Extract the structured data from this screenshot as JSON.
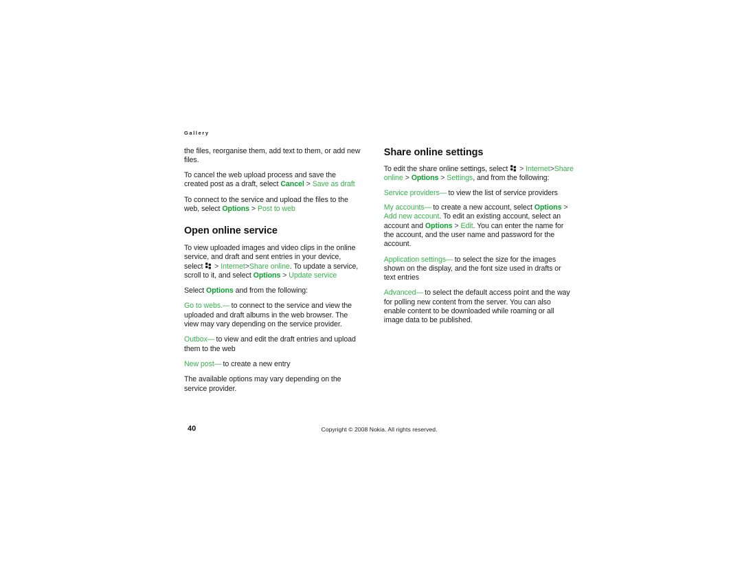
{
  "page": {
    "running_head": "Gallery",
    "folio": "40",
    "copyright": "Copyright © 2008 Nokia. All rights reserved."
  },
  "left_column": {
    "para_continued": {
      "text": "the files, reorganise them, add text to them, or add new files."
    },
    "para_cancel": {
      "lead": "To cancel the web upload process and save the created post as a draft, select ",
      "ui_cancel": "Cancel",
      "sep": " > ",
      "ui_save_as_draft": "Save as draft"
    },
    "para_connect": {
      "lead": "To connect to the service and upload the files to the web, select ",
      "ui_options": "Options",
      "sep": " > ",
      "ui_post_to_web": "Post to web"
    },
    "heading_open_online_service": "Open online service",
    "para_view": {
      "lead": "To view uploaded images and video clips in the online service, and draft and sent entries in your device, select ",
      "icon": "menu-grid-icon",
      "sep1": " > ",
      "ui_internet": "Internet",
      "sep2": ">",
      "ui_share_online": "Share online",
      "mid": ". To update a service, scroll to it, and select ",
      "ui_options": "Options",
      "sep3": " > ",
      "ui_update_service": "Update service"
    },
    "para_select_options": {
      "lead": "Select ",
      "ui_options": "Options",
      "tail": " and from the following:"
    },
    "item_go_to_webs": {
      "term": "Go to webs.",
      "dash": "—",
      "desc": " to connect to the service and view the uploaded and draft albums in the web browser. The view may vary depending on the service provider."
    },
    "item_outbox": {
      "term": "Outbox",
      "dash": "—",
      "desc": " to view and edit the draft entries and upload them to the web"
    },
    "item_new_post": {
      "term": "New post",
      "dash": "—",
      "desc": " to create a new entry"
    },
    "para_available_options": {
      "text": "The available options may vary depending on the service provider."
    }
  },
  "right_column": {
    "heading_share_online_settings": "Share online settings",
    "para_edit": {
      "lead": "To edit the share online settings, select ",
      "icon": "menu-grid-icon",
      "sep1": " > ",
      "ui_internet": "Internet",
      "sep2": ">",
      "ui_share_online": "Share online",
      "sep3": " > ",
      "ui_options": "Options",
      "sep4": " > ",
      "ui_settings": "Settings",
      "tail": ", and from the following:"
    },
    "item_service_providers": {
      "term": "Service providers",
      "dash": "—",
      "desc": " to view the list of service providers"
    },
    "item_my_accounts": {
      "term": "My accounts",
      "dash": "—",
      "desc1": " to create a new account, select ",
      "ui_options": "Options",
      "sep1": " > ",
      "ui_add_new_account": "Add new account",
      "desc2": ". To edit an existing account, select an account and ",
      "ui_options2": "Options",
      "sep2": " > ",
      "ui_edit": "Edit",
      "desc3": ". You can enter the name for the account, and the user name and password for the account."
    },
    "item_application_settings": {
      "term": "Application settings",
      "dash": "—",
      "desc": " to select the size for the images shown on the display, and the font size used in drafts or text entries"
    },
    "item_advanced": {
      "term": "Advanced",
      "dash": "—",
      "desc": " to select the default access point and the way for polling new content from the server. You can also enable content to be downloaded while roaming or all image data to be published."
    }
  },
  "colors": {
    "ui_green": "#35b14a",
    "ui_green_bold": "#0aa02e",
    "text": "#1a1a1a",
    "background": "#ffffff"
  }
}
